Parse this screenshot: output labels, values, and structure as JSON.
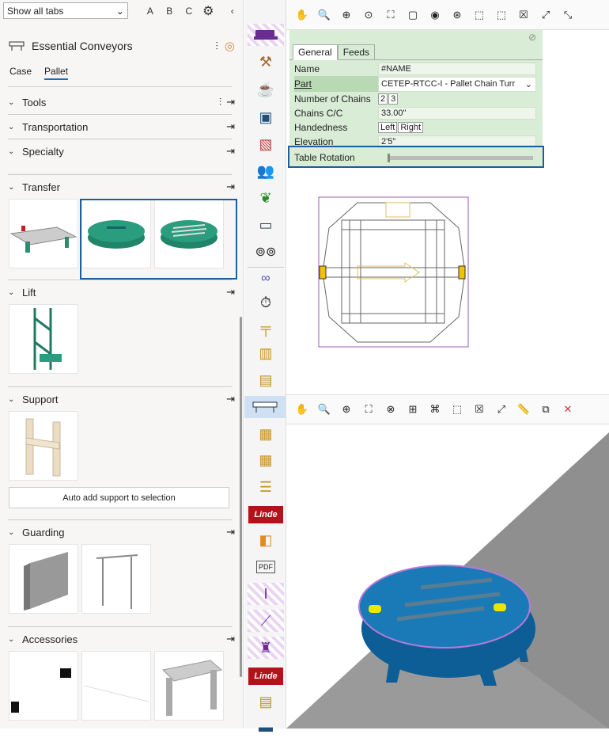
{
  "topbar": {
    "select_value": "Show all tabs",
    "btn_a": "A",
    "btn_b": "B",
    "btn_c": "C"
  },
  "library": {
    "title": "Essential Conveyors"
  },
  "tabs": {
    "case": "Case",
    "pallet": "Pallet"
  },
  "sections": {
    "tools": "Tools",
    "transportation": "Transportation",
    "specialty": "Specialty",
    "transfer": "Transfer",
    "lift": "Lift",
    "support": "Support",
    "guarding": "Guarding",
    "accessories": "Accessories"
  },
  "support": {
    "auto_add": "Auto add support to selection"
  },
  "properties": {
    "tab_general": "General",
    "tab_feeds": "Feeds",
    "name_label": "Name",
    "name_value": "#NAME",
    "part_label": "Part",
    "part_value": "CETEP-RTCC-I - Pallet Chain Turr",
    "chains_label": "Number of Chains",
    "chains_opt1": "2",
    "chains_opt2": "3",
    "cc_label": "Chains C/C",
    "cc_value": "33.00\"",
    "hand_label": "Handedness",
    "hand_left": "Left",
    "hand_right": "Right",
    "elev_label": "Elevation",
    "elev_value": "2'5\"",
    "rot_label": "Table Rotation",
    "rot_value": 0
  },
  "strip": {
    "linde1": "Linde",
    "linde2": "Linde",
    "pdf": "PDF"
  },
  "colors": {
    "accent": "#1a6fb5",
    "highlight": "#1a5e9a",
    "teal": "#2a9d7e",
    "machine": "#1a7ab8",
    "linde": "#b3121b"
  }
}
